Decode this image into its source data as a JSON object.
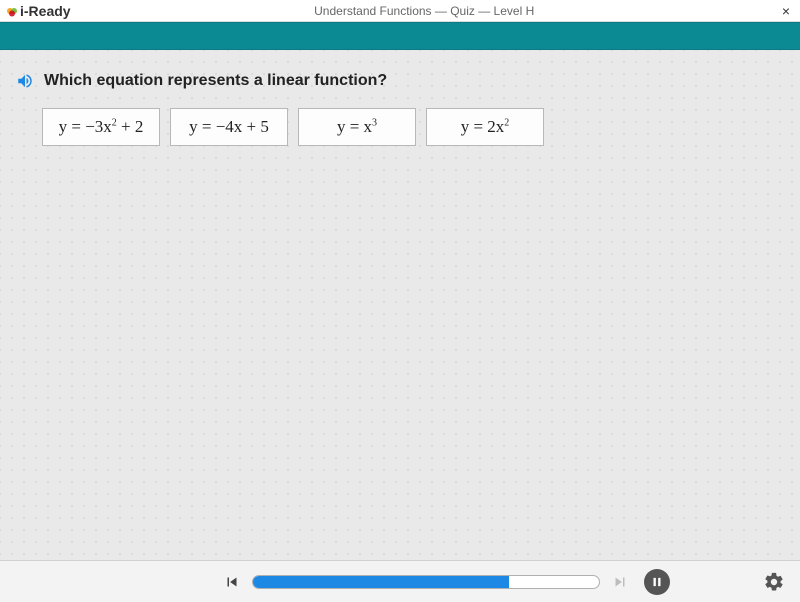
{
  "header": {
    "brand": "i-Ready",
    "title": "Understand Functions — Quiz — Level H",
    "close_label": "×"
  },
  "question": {
    "prompt": "Which equation represents a linear function?"
  },
  "options": [
    {
      "display": "y = −3x² + 2",
      "base": "y = −3x",
      "exp": "2",
      "tail": " + 2"
    },
    {
      "display": "y = −4x + 5",
      "base": "y = −4x + 5",
      "exp": "",
      "tail": ""
    },
    {
      "display": "y = x³",
      "base": "y = x",
      "exp": "3",
      "tail": ""
    },
    {
      "display": "y = 2x²",
      "base": "y = 2x",
      "exp": "2",
      "tail": ""
    }
  ],
  "progress": {
    "percent": 74
  },
  "icons": {
    "audio": "audio-icon",
    "prev": "skip-previous-icon",
    "next": "skip-next-icon",
    "pause": "pause-icon",
    "settings": "gear-icon",
    "close": "close-icon"
  }
}
